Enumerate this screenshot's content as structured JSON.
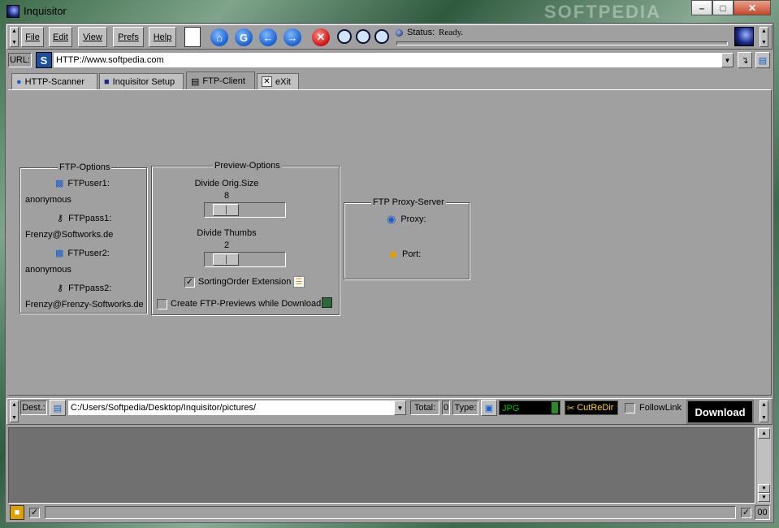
{
  "window": {
    "title": "Inquisitor",
    "watermark": "SOFTPEDIA"
  },
  "menu": [
    "File",
    "Edit",
    "View",
    "Prefs",
    "Help"
  ],
  "status": {
    "label": "Status:",
    "text": "Ready."
  },
  "url": {
    "label": "URL:",
    "value": "HTTP://www.softpedia.com"
  },
  "tabs": [
    {
      "label": "HTTP-Scanner",
      "icon": "globe-icon"
    },
    {
      "label": "Inquisitor Setup",
      "icon": "moon-icon"
    },
    {
      "label": "FTP-Client",
      "icon": "computer-icon",
      "active": true
    },
    {
      "label": "eXit",
      "icon": "close-icon"
    }
  ],
  "ftp_options": {
    "title": "FTP-Options",
    "user1_label": "FTPuser1:",
    "user1": "anonymous",
    "pass1_label": "FTPpass1:",
    "pass1": "Frenzy@Softworks.de",
    "user2_label": "FTPuser2:",
    "user2": "anonymous",
    "pass2_label": "FTPpass2:",
    "pass2": "Frenzy@Frenzy-Softworks.de"
  },
  "preview_options": {
    "title": "Preview-Options",
    "divide_orig_label": "Divide Orig.Size",
    "divide_orig_value": "8",
    "divide_thumbs_label": "Divide Thumbs",
    "divide_thumbs_value": "2",
    "sorting_label": "SortingOrder Extension",
    "sorting_checked": true,
    "create_label": "Create FTP-Previews while Download",
    "create_checked": false
  },
  "proxy": {
    "title": "FTP Proxy-Server",
    "proxy_label": "Proxy:",
    "proxy_value": "",
    "port_label": "Port:",
    "port_value": ""
  },
  "bottom": {
    "dest_label": "Dest.:",
    "dest_value": "C:/Users/Softpedia/Desktop/Inquisitor/pictures/",
    "total_label": "Total:",
    "total_value": "0",
    "type_label": "Type:",
    "type_value": "JPG",
    "cutredir_label": "CutReDir",
    "followlink_label": "FollowLink",
    "followlink_checked": false,
    "download_label": "Download"
  },
  "statusbar": {
    "counter": "00"
  },
  "colors": {
    "frame": "#a0a0a0",
    "type_field_bg": "#000000",
    "type_field_fg": "#00c000",
    "download_bg": "#000000",
    "cutredir_fg": "#ffd700"
  }
}
